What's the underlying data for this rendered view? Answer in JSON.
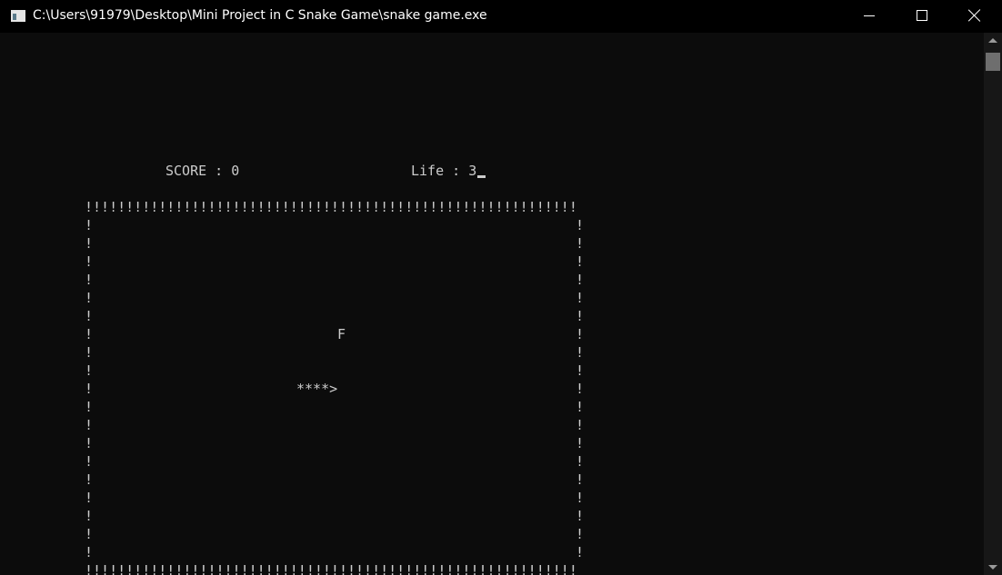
{
  "window": {
    "title": "C:\\Users\\91979\\Desktop\\Mini Project in C Snake Game\\snake game.exe",
    "icon": "console-app-icon"
  },
  "colors": {
    "console_bg": "#0c0c0c",
    "console_text": "#cccccc",
    "titlebar_bg": "#000000"
  },
  "game": {
    "score_text": "SCORE : 0",
    "life_text": "Life : 3",
    "border_top": "!!!!!!!!!!!!!!!!!!!!!!!!!!!!!!!!!!!!!!!!!!!!!!!!!!!!!!!!!!!!",
    "border_bottom": "!!!!!!!!!!!!!!!!!!!!!!!!!!!!!!!!!!!!!!!!!!!!!!!!!!!!!!!!!!!!",
    "wall_char": "!",
    "food": "F",
    "snake": "****>"
  }
}
